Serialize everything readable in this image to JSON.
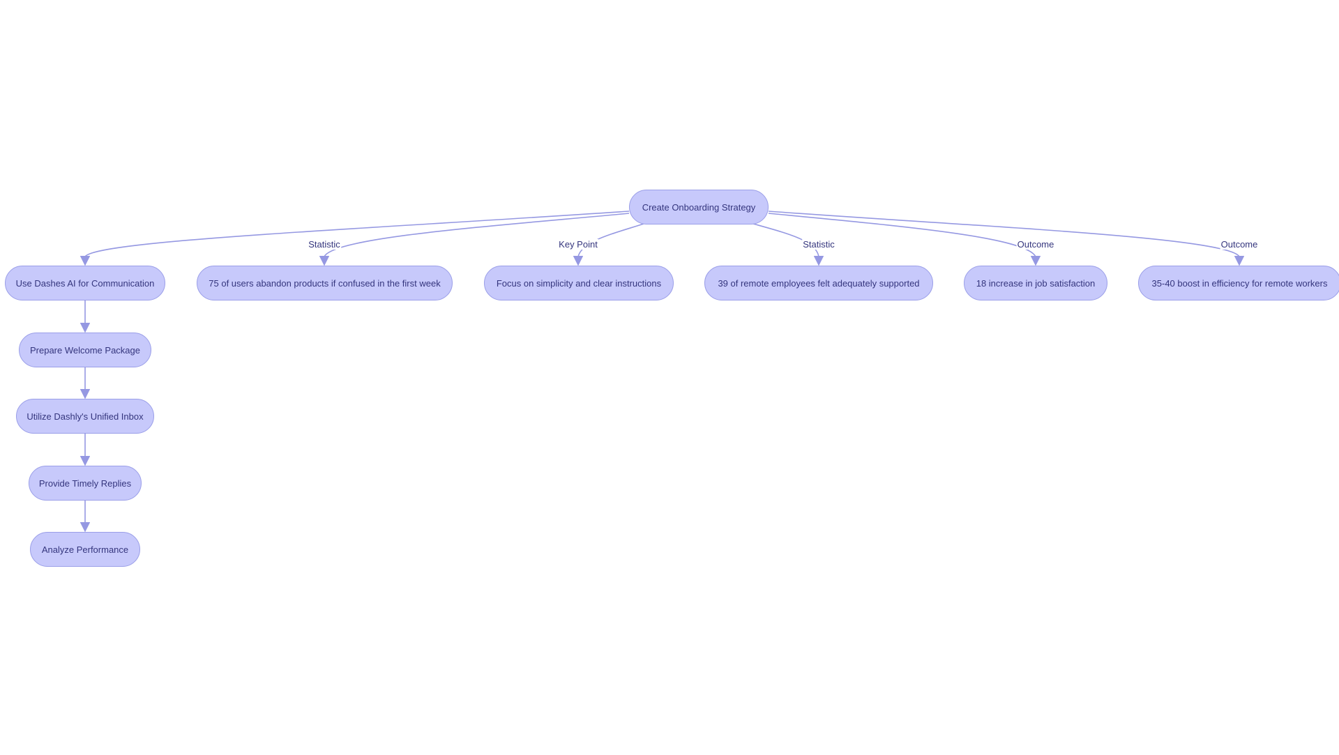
{
  "diagram": {
    "type": "flowchart",
    "colors": {
      "node_fill": "#c7c9fb",
      "node_border": "#9a9ee8",
      "edge": "#9598e2",
      "text": "#34357d"
    },
    "nodes": [
      {
        "id": "root",
        "label": "Create Onboarding Strategy"
      },
      {
        "id": "n1",
        "label": "Use Dashes AI for Communication"
      },
      {
        "id": "n2",
        "label": "75 of users abandon products if confused in the first week"
      },
      {
        "id": "n3",
        "label": "Focus on simplicity and clear instructions"
      },
      {
        "id": "n4",
        "label": "39 of remote employees felt adequately supported"
      },
      {
        "id": "n5",
        "label": "18 increase in job satisfaction"
      },
      {
        "id": "n6",
        "label": "35-40 boost in efficiency for remote workers"
      },
      {
        "id": "n7",
        "label": "Prepare Welcome Package"
      },
      {
        "id": "n8",
        "label": "Utilize Dashly's Unified Inbox"
      },
      {
        "id": "n9",
        "label": "Provide Timely Replies"
      },
      {
        "id": "n10",
        "label": "Analyze Performance"
      }
    ],
    "edges": [
      {
        "from": "root",
        "to": "n1",
        "label": ""
      },
      {
        "from": "root",
        "to": "n2",
        "label": "Statistic"
      },
      {
        "from": "root",
        "to": "n3",
        "label": "Key Point"
      },
      {
        "from": "root",
        "to": "n4",
        "label": "Statistic"
      },
      {
        "from": "root",
        "to": "n5",
        "label": "Outcome"
      },
      {
        "from": "root",
        "to": "n6",
        "label": "Outcome"
      },
      {
        "from": "n1",
        "to": "n7",
        "label": ""
      },
      {
        "from": "n7",
        "to": "n8",
        "label": ""
      },
      {
        "from": "n8",
        "to": "n9",
        "label": ""
      },
      {
        "from": "n9",
        "to": "n10",
        "label": ""
      }
    ]
  }
}
